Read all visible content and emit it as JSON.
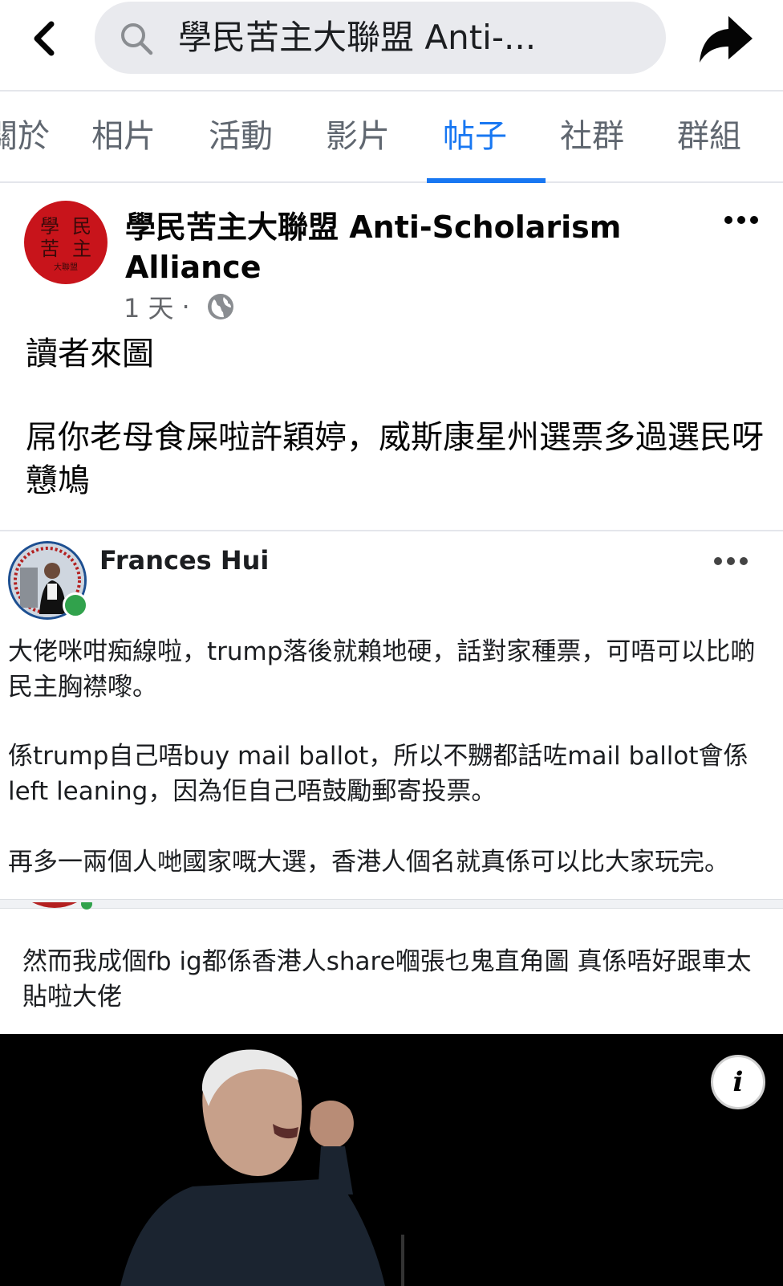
{
  "header": {
    "search_text": "學民苦主大聯盟 Anti-...",
    "back_icon": "chevron-left-icon",
    "search_icon": "search-icon",
    "share_icon": "share-arrow-icon"
  },
  "tabs": [
    {
      "label": "關於"
    },
    {
      "label": "相片"
    },
    {
      "label": "活動"
    },
    {
      "label": "影片"
    },
    {
      "label": "帖子",
      "active": true
    },
    {
      "label": "社群"
    },
    {
      "label": "群組"
    }
  ],
  "post": {
    "page_name": "學民苦主大聯盟 Anti-Scholarism Alliance",
    "avatar_text": [
      "學",
      "民",
      "苦",
      "主",
      "大聯盟"
    ],
    "time": "1 天",
    "separator": "·",
    "visibility_icon": "globe-icon",
    "text_line1": "讀者來圖",
    "text_line2": "屌你老母食屎啦許穎婷，威斯康星州選票多過選民呀戇鳩",
    "colors": {
      "accent": "#1877f2",
      "avatar_bg": "#c8141b"
    }
  },
  "embedded": {
    "author": "Frances Hui",
    "paragraph1": "大佬咪咁痴線啦，trump落後就賴地硬，話對家種票，可唔可以比啲民主胸襟嚟。",
    "paragraph2": "係trump自己唔buy mail ballot，所以不嬲都話咗mail ballot會係left leaning，因為佢自己唔鼓勵郵寄投票。",
    "paragraph3": "再多一兩個人哋國家嘅大選，香港人個名就真係可以比大家玩完。",
    "second_comment": "然而我成個fb ig都係香港人share嗰張乜鬼直角圖 真係唔好跟車太貼啦大佬",
    "info_label": "i"
  }
}
